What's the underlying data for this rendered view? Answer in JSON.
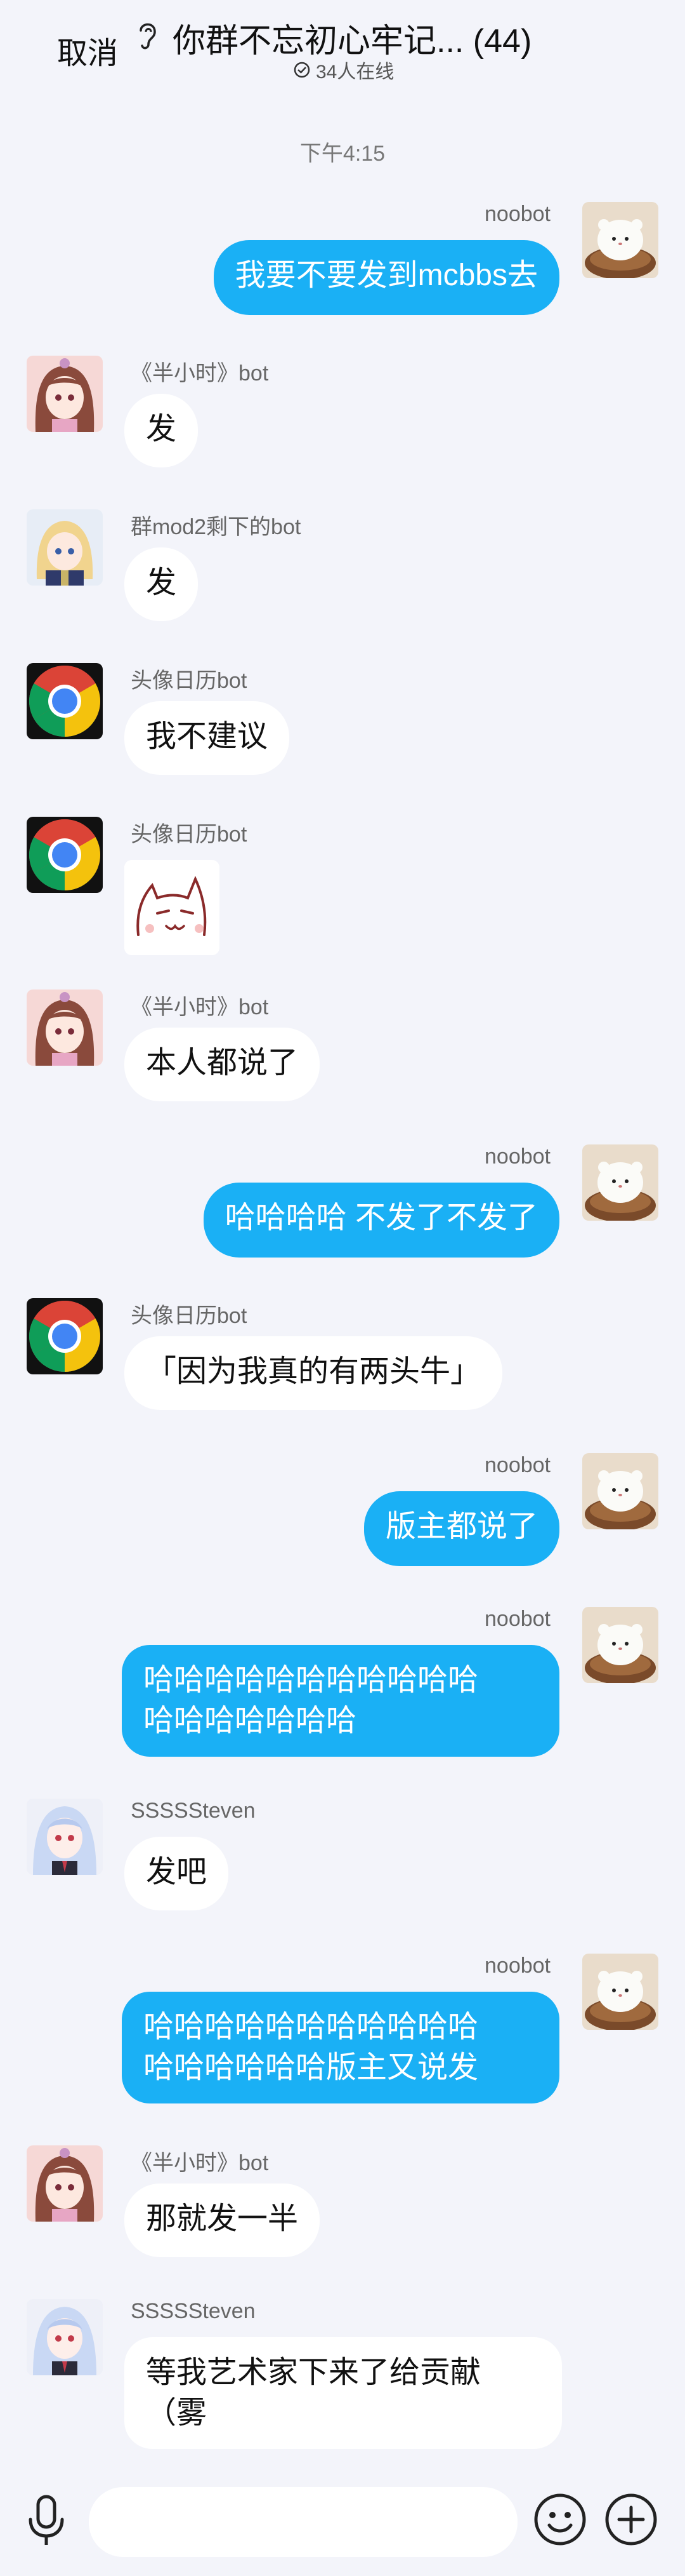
{
  "header": {
    "cancel_label": "取消",
    "title": "你群不忘初心牢记... (44)",
    "online": "34人在线"
  },
  "timestamp": "下午4:15",
  "messages": [
    {
      "side": "right",
      "nick": "noobot",
      "text": "我要不要发到mcbbs去",
      "avatar": "white-cat-avatar"
    },
    {
      "side": "left",
      "nick": "《半小时》bot",
      "text": "发",
      "avatar": "anime-girl-pink-avatar"
    },
    {
      "side": "left",
      "nick": "群mod2剩下的bot",
      "text": "发",
      "avatar": "anime-girl-blonde-avatar"
    },
    {
      "side": "left",
      "nick": "头像日历bot",
      "text": "我不建议",
      "avatar": "chrome-logo-avatar"
    },
    {
      "side": "left",
      "nick": "头像日历bot",
      "text": "",
      "sticker": "cat-face-sticker",
      "avatar": "chrome-logo-avatar"
    },
    {
      "side": "left",
      "nick": "《半小时》bot",
      "text": "本人都说了",
      "avatar": "anime-girl-pink-avatar"
    },
    {
      "side": "right",
      "nick": "noobot",
      "text": "哈哈哈哈 不发了不发了",
      "avatar": "white-cat-avatar"
    },
    {
      "side": "left",
      "nick": "头像日历bot",
      "text": "「因为我真的有两头牛」",
      "avatar": "chrome-logo-avatar"
    },
    {
      "side": "right",
      "nick": "noobot",
      "text": "版主都说了",
      "avatar": "white-cat-avatar"
    },
    {
      "side": "right",
      "nick": "noobot",
      "text": "哈哈哈哈哈哈哈哈哈哈哈\n哈哈哈哈哈哈哈",
      "avatar": "white-cat-avatar"
    },
    {
      "side": "left",
      "nick": "SSSSSteven",
      "text": "发吧",
      "avatar": "anime-girl-blue-avatar"
    },
    {
      "side": "right",
      "nick": "noobot",
      "text": "哈哈哈哈哈哈哈哈哈哈哈\n哈哈哈哈哈哈版主又说发",
      "avatar": "white-cat-avatar"
    },
    {
      "side": "left",
      "nick": "《半小时》bot",
      "text": "那就发一半",
      "avatar": "anime-girl-pink-avatar"
    },
    {
      "side": "left",
      "nick": "SSSSSteven",
      "text": "等我艺术家下来了给贡献\n（雾",
      "avatar": "anime-girl-blue-avatar"
    }
  ],
  "bottombar": {
    "input_placeholder": "",
    "icons": [
      "microphone-icon",
      "emoji-icon",
      "plus-icon"
    ]
  },
  "colors": {
    "background": "#f3f4fa",
    "outgoing_bubble": "#1ab0f5",
    "incoming_bubble": "#ffffff"
  }
}
